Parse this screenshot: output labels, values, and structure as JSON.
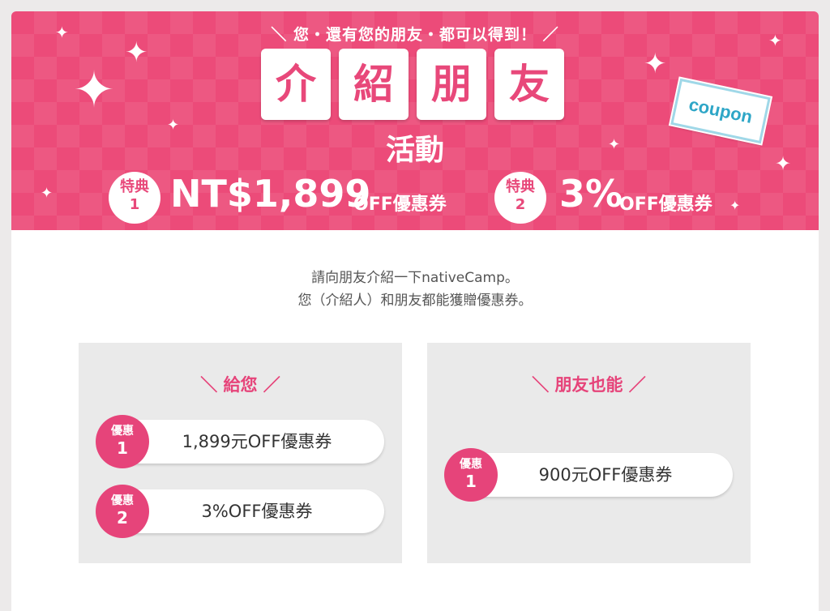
{
  "banner": {
    "subtitle": "＼ 您・還有您的朋友・都可以得到！ ／",
    "title_chars": [
      "介",
      "紹",
      "朋",
      "友"
    ],
    "title_line2": "活動",
    "coupon_label": "coupon",
    "perks": [
      {
        "badge_top": "特典",
        "badge_num": "1",
        "amount": "NT$1,899",
        "suffix": "OFF優惠券"
      },
      {
        "badge_top": "特典",
        "badge_num": "2",
        "amount": "3%",
        "suffix": "OFF優惠券"
      }
    ]
  },
  "intro": {
    "line1": "請向朋友介紹一下nativeCamp。",
    "line2": "您（介紹人）和朋友都能獲贈優惠券。"
  },
  "panels": {
    "you": {
      "heading": "＼ 給您 ／",
      "items": [
        {
          "badge_top": "優惠",
          "badge_num": "1",
          "text": "1,899元OFF優惠券"
        },
        {
          "badge_top": "優惠",
          "badge_num": "2",
          "text": "3%OFF優惠券"
        }
      ]
    },
    "friend": {
      "heading": "＼ 朋友也能 ／",
      "items": [
        {
          "badge_top": "優惠",
          "badge_num": "1",
          "text": "900元OFF優惠券"
        }
      ]
    }
  },
  "colors": {
    "brand_pink": "#e6447a",
    "banner_pink": "#ec4b79",
    "coupon_blue": "#2ea6c7"
  }
}
